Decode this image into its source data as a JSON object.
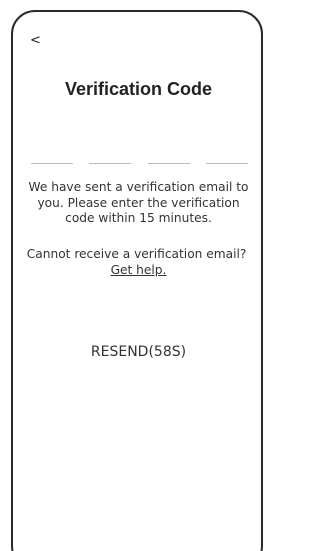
{
  "header": {
    "back_icon": "chevron-left-icon",
    "back_glyph": "<",
    "title": "Verification Code"
  },
  "code_input": {
    "slots": [
      "",
      "",
      "",
      ""
    ]
  },
  "message": {
    "text": "We have sent a verification email to you. Please enter the verification code within 15 minutes."
  },
  "help": {
    "prompt": "Cannot receive a verification email?",
    "link_label": "Get help."
  },
  "resend": {
    "label": "RESEND(58S)"
  },
  "colors": {
    "text": "#333333",
    "frame": "#2a2a2a",
    "underline": "#b9b9b9",
    "background": "#ffffff"
  }
}
